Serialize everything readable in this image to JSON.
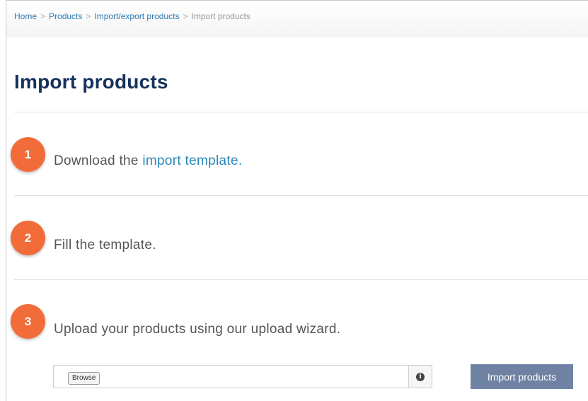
{
  "breadcrumb": {
    "items": [
      "Home",
      "Products",
      "Import/export products"
    ],
    "current": "Import products",
    "separator": ">"
  },
  "page": {
    "title": "Import products"
  },
  "steps": [
    {
      "number": "1",
      "text": "Download the ",
      "link": "import template."
    },
    {
      "number": "2",
      "text": "Fill the template."
    },
    {
      "number": "3",
      "text": "Upload your products using our upload wizard."
    }
  ],
  "upload": {
    "browse_label": "Browse",
    "info_icon": "i",
    "import_label": "Import products"
  },
  "colors": {
    "badge": "#f26c3a",
    "title": "#16325c",
    "link": "#2a86b8",
    "button": "#6f82a3"
  }
}
